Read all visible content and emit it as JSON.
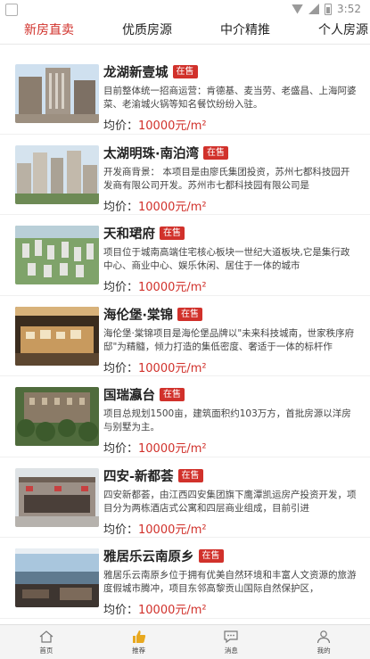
{
  "status_bar": {
    "time": "3:52"
  },
  "tabs": [
    {
      "label": "新房直卖"
    },
    {
      "label": "优质房源"
    },
    {
      "label": "中介精推"
    },
    {
      "label": "个人房源"
    }
  ],
  "colors": {
    "accent": "#d1312b"
  },
  "listings": [
    {
      "title": "龙湖新壹城",
      "badge": "在售",
      "description": "目前整体统一招商运营：肯德基、麦当劳、老盛昌、上海阿婆菜、老渝城火锅等知名餐饮纷纷入驻。",
      "price_label": "均价：",
      "price_value": "10000元/m²"
    },
    {
      "title": "太湖明珠·南泊湾",
      "badge": "在售",
      "description": "开发商背景：  本项目是由廖氏集团投资，苏州七都科技园开发商有限公司开发。苏州市七都科技园有限公司是",
      "price_label": "均价：",
      "price_value": "10000元/m²"
    },
    {
      "title": "天和珺府",
      "badge": "在售",
      "description": "      项目位于城南高端住宅核心板块一世纪大道板块,它是集行政中心、商业中心、娱乐休闲、居住于一体的城市",
      "price_label": "均价：",
      "price_value": "10000元/m²"
    },
    {
      "title": " 海伦堡·棠锦",
      "badge": "在售",
      "description": "海伦堡·棠锦项目是海伦堡品牌以\"未来科技城南，世家秩序府邸\"为精髓，倾力打造的集低密度、奢适于一体的标杆作",
      "price_label": "均价：",
      "price_value": "10000元/m²"
    },
    {
      "title": "国瑞瀛台",
      "badge": "在售",
      "description": "项目总规划1500亩，建筑面积约103万方，首批房源以洋房与别墅为主。",
      "price_label": "均价：",
      "price_value": "10000元/m²"
    },
    {
      "title": "四安-新都荟",
      "badge": "在售",
      "description": "四安新都荟，由江西四安集团旗下鹰潭凯运房产投资开发，项目分为两栋酒店式公寓和四层商业组成，目前引进",
      "price_label": "均价：",
      "price_value": "10000元/m²"
    },
    {
      "title": "雅居乐云南原乡",
      "badge": "在售",
      "description": "雅居乐云南原乡位于拥有优美自然环境和丰富人文资源的旅游度假城市腾冲，项目东邻高黎贡山国际自然保护区，",
      "price_label": "均价：",
      "price_value": "10000元/m²"
    }
  ],
  "bottom_nav": [
    {
      "label": "首页",
      "icon": "home-icon"
    },
    {
      "label": "推荐",
      "icon": "thumbs-up-icon"
    },
    {
      "label": "消息",
      "icon": "message-icon"
    },
    {
      "label": "我的",
      "icon": "user-icon"
    }
  ]
}
